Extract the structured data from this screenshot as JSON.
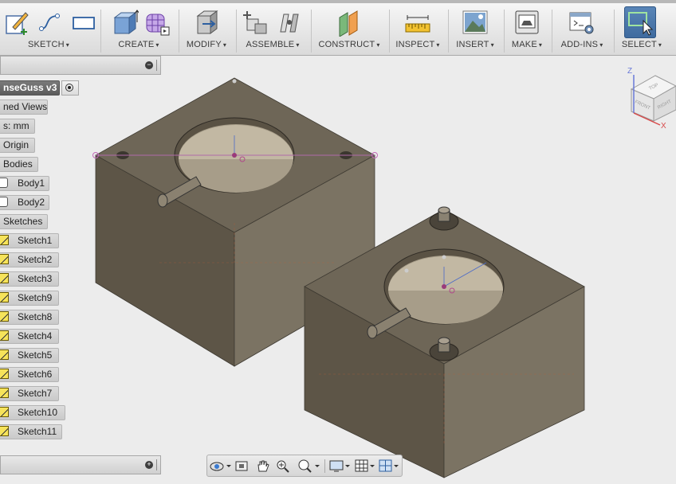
{
  "toolbar": {
    "groups": [
      {
        "label": "SKETCH"
      },
      {
        "label": "CREATE"
      },
      {
        "label": "MODIFY"
      },
      {
        "label": "ASSEMBLE"
      },
      {
        "label": "CONSTRUCT"
      },
      {
        "label": "INSPECT"
      },
      {
        "label": "INSERT"
      },
      {
        "label": "MAKE"
      },
      {
        "label": "ADD-INS"
      },
      {
        "label": "SELECT"
      }
    ],
    "caret": "▾",
    "accent": "#4a78ad"
  },
  "browser": {
    "root": "nseGuss v3",
    "items": [
      {
        "label": "ned Views"
      },
      {
        "label": "s: mm"
      },
      {
        "label": "Origin"
      },
      {
        "label": "Bodies"
      },
      {
        "label": "Body1"
      },
      {
        "label": "Body2"
      },
      {
        "label": "Sketches"
      },
      {
        "label": "Sketch1"
      },
      {
        "label": "Sketch2"
      },
      {
        "label": "Sketch3"
      },
      {
        "label": "Sketch9"
      },
      {
        "label": "Sketch8"
      },
      {
        "label": "Sketch4"
      },
      {
        "label": "Sketch5"
      },
      {
        "label": "Sketch6"
      },
      {
        "label": "Sketch7"
      },
      {
        "label": "Sketch10"
      },
      {
        "label": "Sketch11"
      }
    ],
    "minimize_glyph": "−",
    "foot_glyph": "+"
  },
  "viewcube": {
    "faces": {
      "top": "TOP",
      "front": "FRONT",
      "right": "RIGHT"
    },
    "axes": {
      "x": "X",
      "z": "Z"
    }
  },
  "colors": {
    "model_top": "#6e6657",
    "model_left": "#5c5446",
    "model_right": "#7c7464",
    "pocket": "#a49a86"
  }
}
